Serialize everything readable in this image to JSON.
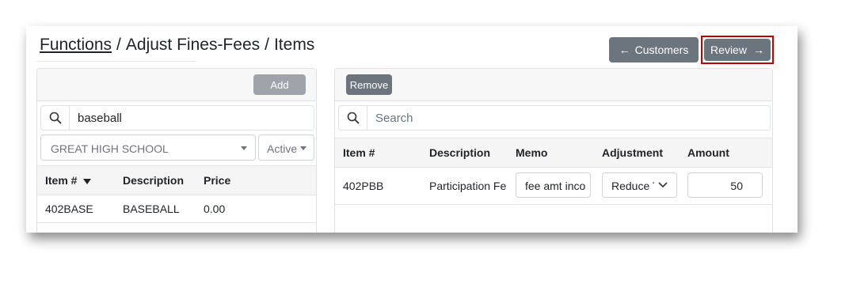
{
  "breadcrumb": {
    "functions": "Functions",
    "sep1": "/",
    "adjust": "Adjust Fines-Fees",
    "sep2": "/",
    "items": "Items"
  },
  "nav": {
    "customers_label": "Customers",
    "customers_arrow": "←",
    "review_label": "Review",
    "review_arrow": "→"
  },
  "left": {
    "add_label": "Add",
    "search_value": "baseball",
    "school_select": "GREAT HIGH SCHOOL",
    "status_select": "Active",
    "columns": {
      "item": "Item #",
      "description": "Description",
      "price": "Price"
    },
    "rows": [
      {
        "item": "402BASE",
        "description": "BASEBALL",
        "price": "0.00"
      }
    ]
  },
  "right": {
    "remove_label": "Remove",
    "search_placeholder": "Search",
    "columns": {
      "item": "Item #",
      "description": "Description",
      "memo": "Memo",
      "adjustment": "Adjustment",
      "amount": "Amount"
    },
    "rows": [
      {
        "item": "402PBB",
        "description": "Participation Fe",
        "memo": "fee amt inco",
        "adjustment": "Reduce T",
        "amount": "50"
      }
    ]
  },
  "colors": {
    "button_secondary": "#6c757d",
    "button_disabled": "#9ea4a9",
    "highlight_border": "#c00000"
  }
}
